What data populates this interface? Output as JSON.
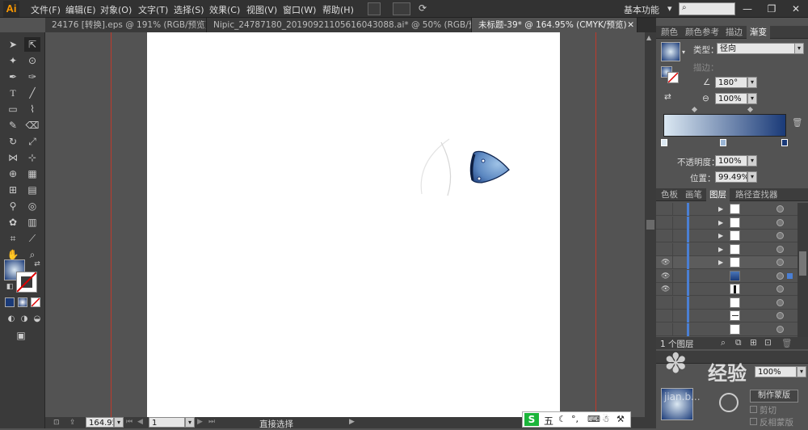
{
  "app": {
    "logo": "Ai"
  },
  "menu": [
    "文件(F)",
    "编辑(E)",
    "对象(O)",
    "文字(T)",
    "选择(S)",
    "效果(C)",
    "视图(V)",
    "窗口(W)",
    "帮助(H)"
  ],
  "workspace": {
    "label": "基本功能",
    "arrow": "▾"
  },
  "window_buttons": [
    "—",
    "❐",
    "✕"
  ],
  "tabs": [
    {
      "label": "24176 [转换].eps @ 191% (RGB/预览)"
    },
    {
      "label": "Nipic_24787180_20190921105616043088.ai* @ 50% (RGB/预览)"
    },
    {
      "label": "未标题-39* @ 164.95% (CMYK/预览)",
      "close": "✕"
    }
  ],
  "gradient_panel": {
    "tabs": [
      "颜色",
      "颜色参考",
      "描边",
      "渐变"
    ],
    "type_label": "类型：",
    "type_value": "径向",
    "stroke_label": "描边：",
    "angle_value": "180°",
    "aspect_value": "100%",
    "opacity_label": "不透明度：",
    "opacity_value": "100%",
    "location_label": "位置：",
    "location_value": "99.49%",
    "colors": {
      "start": "#dbe8f2",
      "end": "#1a3a78"
    }
  },
  "layers_panel": {
    "tabs": [
      "色板",
      "画笔",
      "图层",
      "路径查找器"
    ],
    "footer_label": "1 个图层",
    "rows": [
      {
        "eye": "",
        "expand": "▶"
      },
      {
        "eye": "",
        "expand": "▶"
      },
      {
        "eye": "",
        "expand": "▶"
      },
      {
        "eye": "",
        "expand": "▶"
      },
      {
        "eye": "👁",
        "expand": "▶"
      },
      {
        "eye": "👁",
        "expand": ""
      },
      {
        "eye": "👁",
        "expand": ""
      },
      {
        "eye": "",
        "expand": ""
      },
      {
        "eye": "",
        "expand": ""
      },
      {
        "eye": "",
        "expand": ""
      }
    ]
  },
  "transparency": {
    "opacity_value": "100%",
    "make_mask": "制作蒙版",
    "clip": "剪切",
    "invert_mask": "反相蒙版"
  },
  "status": {
    "zoom": "164.95",
    "page": "1",
    "tool_name": "直接选择"
  },
  "ime": {
    "label": "五"
  },
  "watermark": {
    "text": "经验",
    "url": "jian.b..."
  }
}
